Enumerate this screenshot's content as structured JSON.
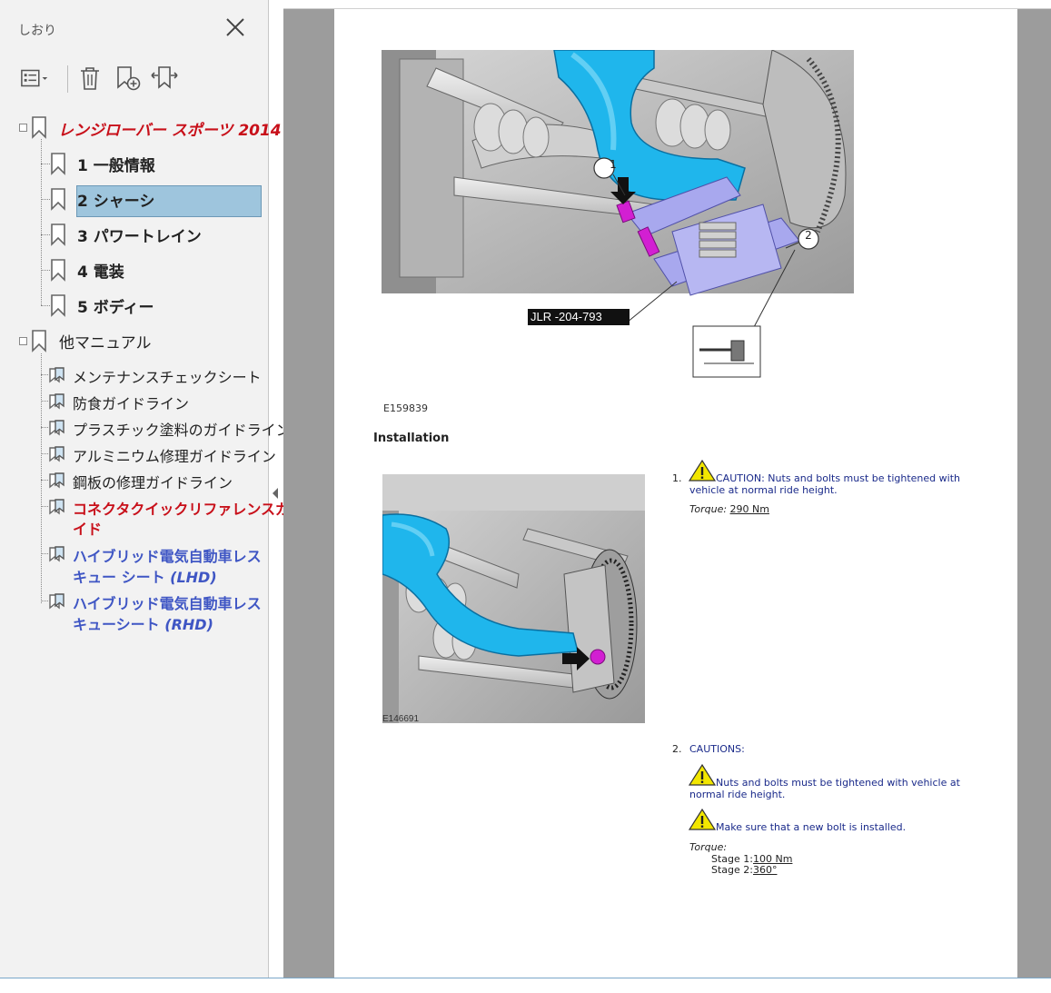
{
  "panel": {
    "title": "しおり",
    "close_icon": "close-icon",
    "toolbar": [
      "options-menu-icon",
      "delete-icon",
      "new-bookmark-icon",
      "expand-bookmark-icon"
    ]
  },
  "bookmarks": {
    "root": "レンジローバー スポーツ 2014",
    "chapters": [
      "1 一般情報",
      "2 シャーシ",
      "3 パワートレイン",
      "4 電装",
      "5 ボディー"
    ],
    "selected_index": 1,
    "other_root": "他マニュアル",
    "other_items": [
      {
        "label": "メンテナンスチェックシート",
        "style": "normal"
      },
      {
        "label": "防食ガイドライン",
        "style": "normal"
      },
      {
        "label": "プラスチック塗料のガイドライン",
        "style": "normal"
      },
      {
        "label": "アルミニウム修理ガイドライン",
        "style": "normal"
      },
      {
        "label": "鋼板の修理ガイドライン",
        "style": "normal"
      },
      {
        "label_l1": "コネクタクイックリファレンスガ",
        "label_l2": "イド",
        "style": "red"
      },
      {
        "label_l1": "ハイブリッド電気自動車レス",
        "label_l2a": "キュー シート ",
        "label_l2b": "(LHD)",
        "style": "blue"
      },
      {
        "label_l1": "ハイブリッド電気自動車レス",
        "label_l2a": "キューシート ",
        "label_l2b": "(RHD)",
        "style": "blue"
      }
    ]
  },
  "document": {
    "figure1": {
      "callout1": "1",
      "callout2": "2",
      "tool_label": "JLR -204-793",
      "caption": "E159839"
    },
    "heading": "Installation",
    "figure2": {
      "caption": "E146691"
    },
    "step1": {
      "number": "1.",
      "caution": "CAUTION: Nuts and bolts must be tightened with vehicle at normal ride height.",
      "torque_label": "Torque:",
      "torque_value": "290 Nm"
    },
    "step2": {
      "number": "2.",
      "cautions_title": "CAUTIONS:",
      "caution_a": "Nuts and bolts must be tightened with vehicle at normal ride height.",
      "caution_b": "Make sure that a new bolt is installed.",
      "torque_label": "Torque:",
      "stage1_label": "Stage 1:",
      "stage1_value": "100 Nm",
      "stage2_label": "Stage 2:",
      "stage2_value": "360°"
    }
  },
  "colors": {
    "red": "#c8101a",
    "blue": "#3f56c4",
    "selected": "#9ec5dd",
    "caution_text": "#1a2a8a",
    "cyan_part": "#18b4e8",
    "purple_tool": "#a8a8ee",
    "magenta_bolt": "#d21fd2"
  }
}
